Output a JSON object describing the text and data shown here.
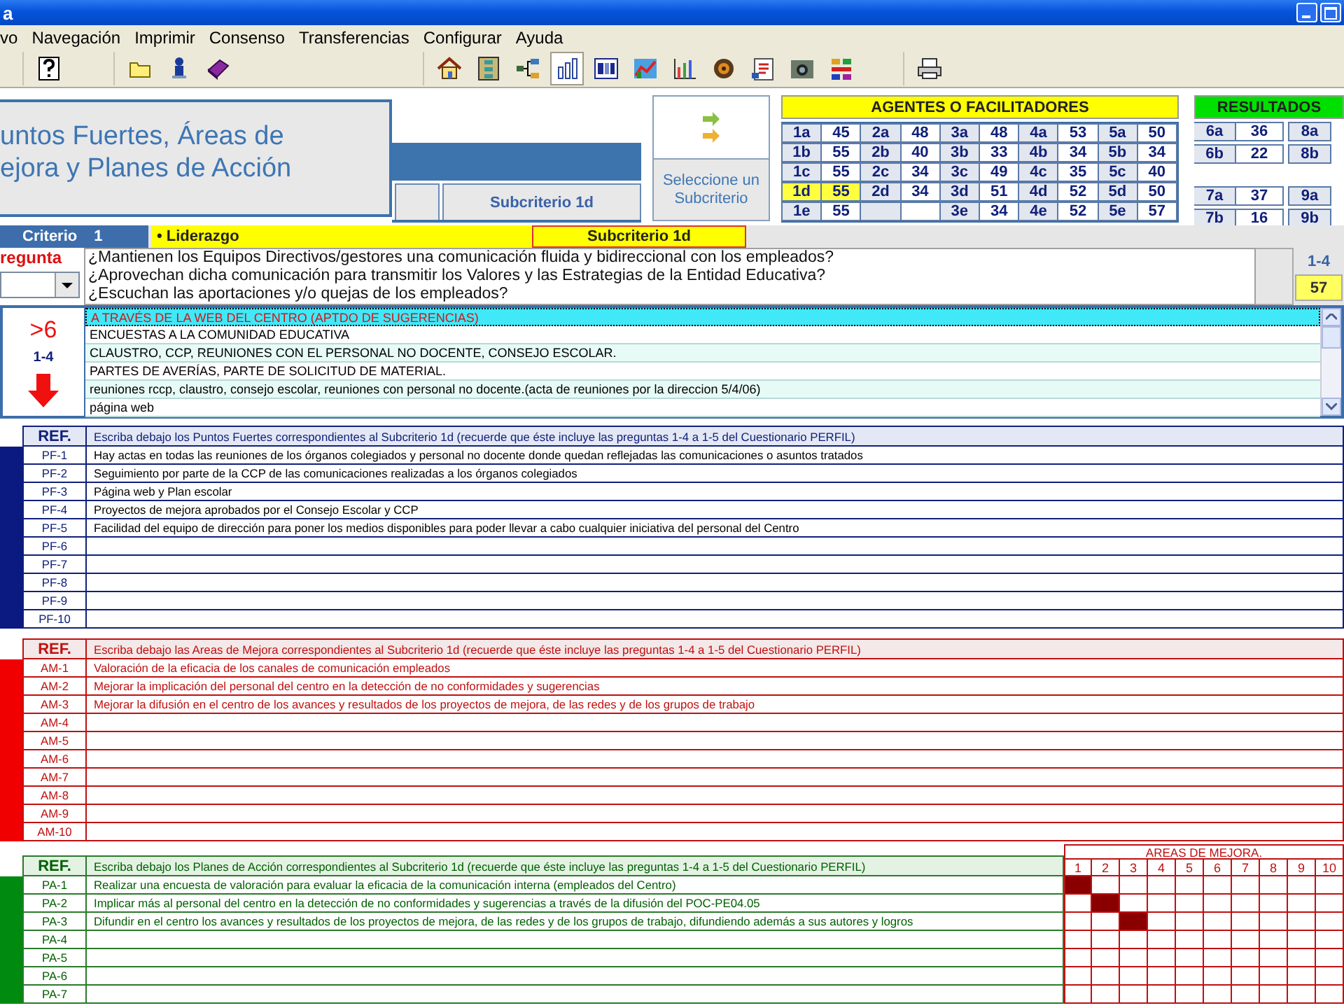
{
  "window": {
    "title": "a",
    "controls": [
      {
        "kind": "minimize"
      },
      {
        "kind": "maximize"
      }
    ]
  },
  "menu": [
    "vo",
    "Navegación",
    "Imprimir",
    "Consenso",
    "Transferencias",
    "Configurar",
    "Ayuda"
  ],
  "toolbar": [
    {
      "items": [
        {
          "kind": "help",
          "pressed": false
        }
      ]
    },
    {
      "items": [
        {
          "kind": "folder",
          "pressed": false
        },
        {
          "kind": "person",
          "pressed": false
        },
        {
          "kind": "book",
          "pressed": false
        }
      ]
    },
    {
      "items": [
        {
          "kind": "home",
          "pressed": false
        },
        {
          "kind": "flowchart",
          "pressed": false
        },
        {
          "kind": "network",
          "pressed": false
        },
        {
          "kind": "columns",
          "pressed": true
        },
        {
          "kind": "model",
          "pressed": false
        },
        {
          "kind": "chart",
          "pressed": false
        },
        {
          "kind": "bars",
          "pressed": false
        },
        {
          "kind": "disc",
          "pressed": false
        },
        {
          "kind": "checklist",
          "pressed": false
        },
        {
          "kind": "camera",
          "pressed": false
        },
        {
          "kind": "blocks",
          "pressed": false
        }
      ]
    },
    {
      "items": [
        {
          "kind": "printer",
          "pressed": false
        }
      ]
    }
  ],
  "header": {
    "title_lines": [
      "untos Fuertes, Áreas de",
      "ejora y Planes de Acción"
    ],
    "subcriterio": "Subcriterio 1d",
    "selector": "Seleccione un Subcriterio"
  },
  "agentes": {
    "title": "AGENTES O FACILITADORES",
    "rows": [
      [
        {
          "code": "1a",
          "score": "45",
          "selected": false
        },
        {
          "code": "2a",
          "score": "48",
          "selected": false
        },
        {
          "code": "3a",
          "score": "48",
          "selected": false
        },
        {
          "code": "4a",
          "score": "53",
          "selected": false
        },
        {
          "code": "5a",
          "score": "50",
          "selected": false
        }
      ],
      [
        {
          "code": "1b",
          "score": "55",
          "selected": false
        },
        {
          "code": "2b",
          "score": "40",
          "selected": false
        },
        {
          "code": "3b",
          "score": "33",
          "selected": false
        },
        {
          "code": "4b",
          "score": "34",
          "selected": false
        },
        {
          "code": "5b",
          "score": "34",
          "selected": false
        }
      ],
      [
        {
          "code": "1c",
          "score": "55",
          "selected": false
        },
        {
          "code": "2c",
          "score": "34",
          "selected": false
        },
        {
          "code": "3c",
          "score": "49",
          "selected": false
        },
        {
          "code": "4c",
          "score": "35",
          "selected": false
        },
        {
          "code": "5c",
          "score": "40",
          "selected": false
        }
      ],
      [
        {
          "code": "1d",
          "score": "55",
          "selected": true
        },
        {
          "code": "2d",
          "score": "34",
          "selected": false
        },
        {
          "code": "3d",
          "score": "51",
          "selected": false
        },
        {
          "code": "4d",
          "score": "52",
          "selected": false
        },
        {
          "code": "5d",
          "score": "50",
          "selected": false
        }
      ],
      [
        {
          "code": "1e",
          "score": "55",
          "selected": false
        },
        null,
        {
          "code": "3e",
          "score": "34",
          "selected": false
        },
        {
          "code": "4e",
          "score": "52",
          "selected": false
        },
        {
          "code": "5e",
          "score": "57",
          "selected": false
        }
      ]
    ]
  },
  "resultados": {
    "title": "RESULTADOS",
    "rows": [
      {
        "cells": [
          {
            "code": "6a",
            "score": "36",
            "selected": false
          },
          {
            "code": "8a",
            "selected": false
          }
        ]
      },
      {
        "cells": [
          {
            "code": "6b",
            "score": "22",
            "selected": false
          },
          {
            "code": "8b",
            "selected": false
          }
        ]
      },
      {
        "cells": [
          {
            "code": "7a",
            "score": "37",
            "selected": false
          },
          {
            "code": "9a",
            "selected": false
          }
        ]
      },
      {
        "cells": [
          {
            "code": "7b",
            "score": "16",
            "selected": false
          },
          {
            "code": "9b",
            "selected": false
          }
        ]
      }
    ]
  },
  "criterio": {
    "label": "Criterio",
    "number": "1",
    "name": "• Liderazgo",
    "subcriterio": "Subcriterio 1d"
  },
  "pregunta": {
    "label": "regunta",
    "questions": [
      "¿Mantienen los Equipos Directivos/gestores una comunicación fluida y bidireccional con los empleados?",
      "¿Aprovechan dicha comunicación para transmitir los Valores y las Estrategias de la Entidad Educativa?",
      "¿Escuchan las aportaciones y/o quejas de los empleados?"
    ],
    "range": "1-4",
    "score": "57"
  },
  "evidencias": {
    "score": ">6",
    "range": "1-4",
    "items": [
      {
        "text": "A TRAVÉS DE LA WEB DEL CENTRO (APTDO DE SUGERENCIAS)",
        "selected": true
      },
      {
        "text": "ENCUESTAS A LA COMUNIDAD EDUCATIVA",
        "selected": false
      },
      {
        "text": "CLAUSTRO, CCP, REUNIONES CON EL PERSONAL NO DOCENTE, CONSEJO ESCOLAR.",
        "selected": false
      },
      {
        "text": "PARTES DE AVERÍAS, PARTE DE SOLICITUD DE MATERIAL.",
        "selected": false
      },
      {
        "text": "reuniones rccp, claustro, consejo escolar, reuniones con personal no docente.(acta de reuniones por la direccion 5/4/06)",
        "selected": false
      },
      {
        "text": "página web",
        "selected": false
      }
    ]
  },
  "sections": [
    {
      "kind": "puntos_fuertes",
      "ref_label": "REF.",
      "heading": "Escriba debajo los Puntos Fuertes correspondientes al Subcriterio 1d (recuerde que éste incluye las preguntas 1-4 a 1-5 del Cuestionario PERFIL)",
      "rows": [
        {
          "ref": "PF-1",
          "text": "Hay actas en todas las reuniones de los órganos colegiados y personal no docente donde quedan reflejadas las comunicaciones o asuntos tratados"
        },
        {
          "ref": "PF-2",
          "text": "Seguimiento por parte de la CCP de las comunicaciones realizadas a los órganos colegiados"
        },
        {
          "ref": "PF-3",
          "text": "Página web y Plan escolar"
        },
        {
          "ref": "PF-4",
          "text": "Proyectos de mejora aprobados por el Consejo Escolar y CCP"
        },
        {
          "ref": "PF-5",
          "text": "Facilidad del equipo de dirección para poner los medios disponibles para poder llevar a cabo cualquier iniciativa del personal del Centro"
        },
        {
          "ref": "PF-6"
        },
        {
          "ref": "PF-7"
        },
        {
          "ref": "PF-8"
        },
        {
          "ref": "PF-9"
        },
        {
          "ref": "PF-10"
        }
      ]
    },
    {
      "kind": "areas_mejora",
      "ref_label": "REF.",
      "heading": "Escriba debajo las Areas de Mejora correspondientes al Subcriterio 1d (recuerde que éste incluye las preguntas 1-4 a 1-5 del Cuestionario PERFIL)",
      "rows": [
        {
          "ref": "AM-1",
          "text": "Valoración de la eficacia de los canales de comunicación empleados"
        },
        {
          "ref": "AM-2",
          "text": "Mejorar la implicación del personal del centro en la detección de no conformidades y sugerencias"
        },
        {
          "ref": "AM-3",
          "text": "Mejorar la difusión en el centro de los avances y resultados de los proyectos de mejora, de las redes y de los grupos de trabajo"
        },
        {
          "ref": "AM-4"
        },
        {
          "ref": "AM-5"
        },
        {
          "ref": "AM-6"
        },
        {
          "ref": "AM-7"
        },
        {
          "ref": "AM-8"
        },
        {
          "ref": "AM-9"
        },
        {
          "ref": "AM-10"
        }
      ]
    },
    {
      "kind": "planes_accion",
      "ref_label": "REF.",
      "heading": "Escriba debajo los Planes de Acción correspondientes al Subcriterio 1d (recuerde que éste incluye las preguntas 1-4 a 1-5 del Cuestionario PERFIL)",
      "rows": [
        {
          "ref": "PA-1",
          "text": "Realizar una encuesta de valoración para evaluar la eficacia de la comunicación interna (empleados del Centro)"
        },
        {
          "ref": "PA-2",
          "text": "Implicar más al personal del centro en la detección de no conformidades y sugerencias a través de la difusión del POC-PE04.05"
        },
        {
          "ref": "PA-3",
          "text": "Difundir en el centro los avances y resultados de los proyectos de mejora, de las redes y de los grupos de trabajo, difundiendo además a sus autores y logros"
        },
        {
          "ref": "PA-4"
        },
        {
          "ref": "PA-5"
        },
        {
          "ref": "PA-6"
        },
        {
          "ref": "PA-7"
        }
      ],
      "mejora_grid": {
        "title": "AREAS DE MEJORA.",
        "columns": [
          "1",
          "2",
          "3",
          "4",
          "5",
          "6",
          "7",
          "8",
          "9",
          "10"
        ],
        "rows": [
          [
            true,
            false,
            false,
            false,
            false,
            false,
            false,
            false,
            false,
            false
          ],
          [
            false,
            true,
            false,
            false,
            false,
            false,
            false,
            false,
            false,
            false
          ],
          [
            false,
            false,
            true,
            false,
            false,
            false,
            false,
            false,
            false,
            false
          ],
          [
            false,
            false,
            false,
            false,
            false,
            false,
            false,
            false,
            false,
            false
          ],
          [
            false,
            false,
            false,
            false,
            false,
            false,
            false,
            false,
            false,
            false
          ],
          [
            false,
            false,
            false,
            false,
            false,
            false,
            false,
            false,
            false,
            false
          ],
          [
            false,
            false,
            false,
            false,
            false,
            false,
            false,
            false,
            false,
            false
          ]
        ]
      }
    }
  ]
}
